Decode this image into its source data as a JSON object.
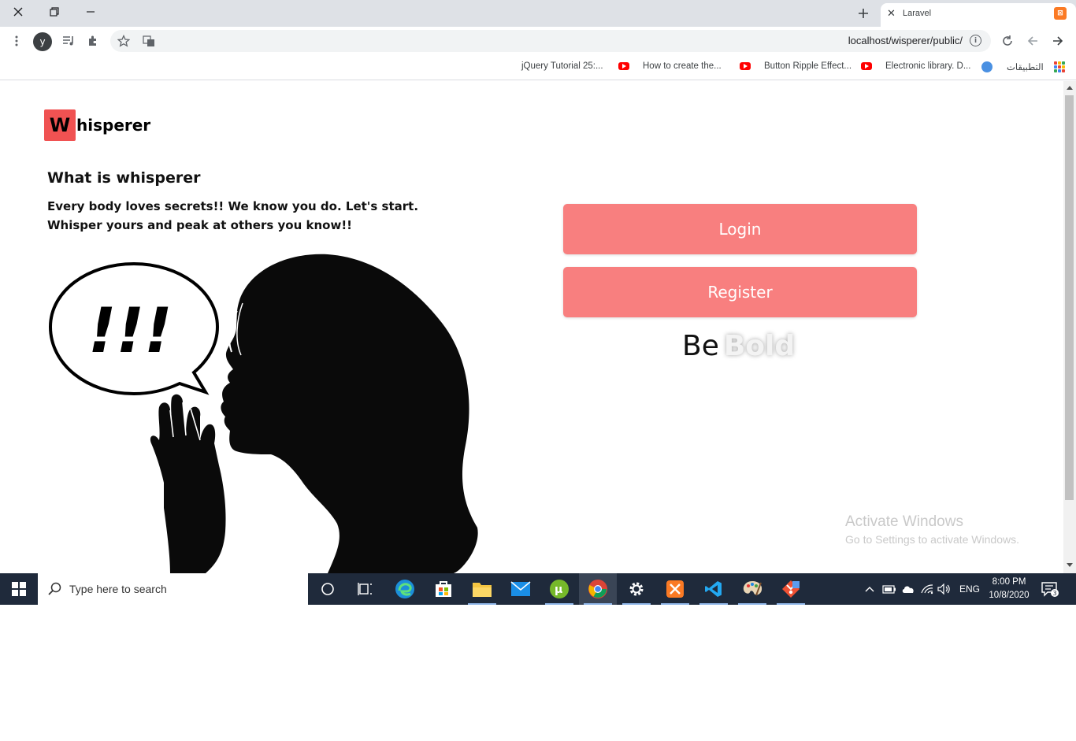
{
  "browser": {
    "tab": {
      "title": "Laravel"
    },
    "address": {
      "url": "localhost/wisperer/public/"
    },
    "profile_initial": "y",
    "bookmarks": [
      {
        "label": "jQuery Tutorial 25:...",
        "icon": "youtube-icon"
      },
      {
        "label": "How to create the...",
        "icon": "youtube-icon"
      },
      {
        "label": "Button Ripple Effect...",
        "icon": "youtube-icon"
      },
      {
        "label": "Electronic library. D...",
        "icon": "globe-icon"
      },
      {
        "label": "التطبيقات",
        "icon": "apps-grid-icon"
      }
    ]
  },
  "page": {
    "logo": {
      "initial": "W",
      "rest": "hisperer"
    },
    "about": {
      "title": "What is whisperer",
      "text": "Every body loves secrets!! We know you do. Let's start. Whisper yours and peak at others you know!!"
    },
    "illustration": {
      "bubble_text": "!!!"
    },
    "buttons": {
      "login": "Login",
      "register": "Register"
    },
    "tagline": {
      "be": "Be",
      "bold": "Bold"
    },
    "colors": {
      "accent": "#f87f7f",
      "logo_red": "#f05252"
    }
  },
  "windows": {
    "watermark_title": "Activate Windows",
    "watermark_sub": "Go to Settings to activate Windows.",
    "search_placeholder": "Type here to search",
    "language": "ENG",
    "time": "8:00 PM",
    "date": "10/8/2020",
    "notifications": "3"
  }
}
